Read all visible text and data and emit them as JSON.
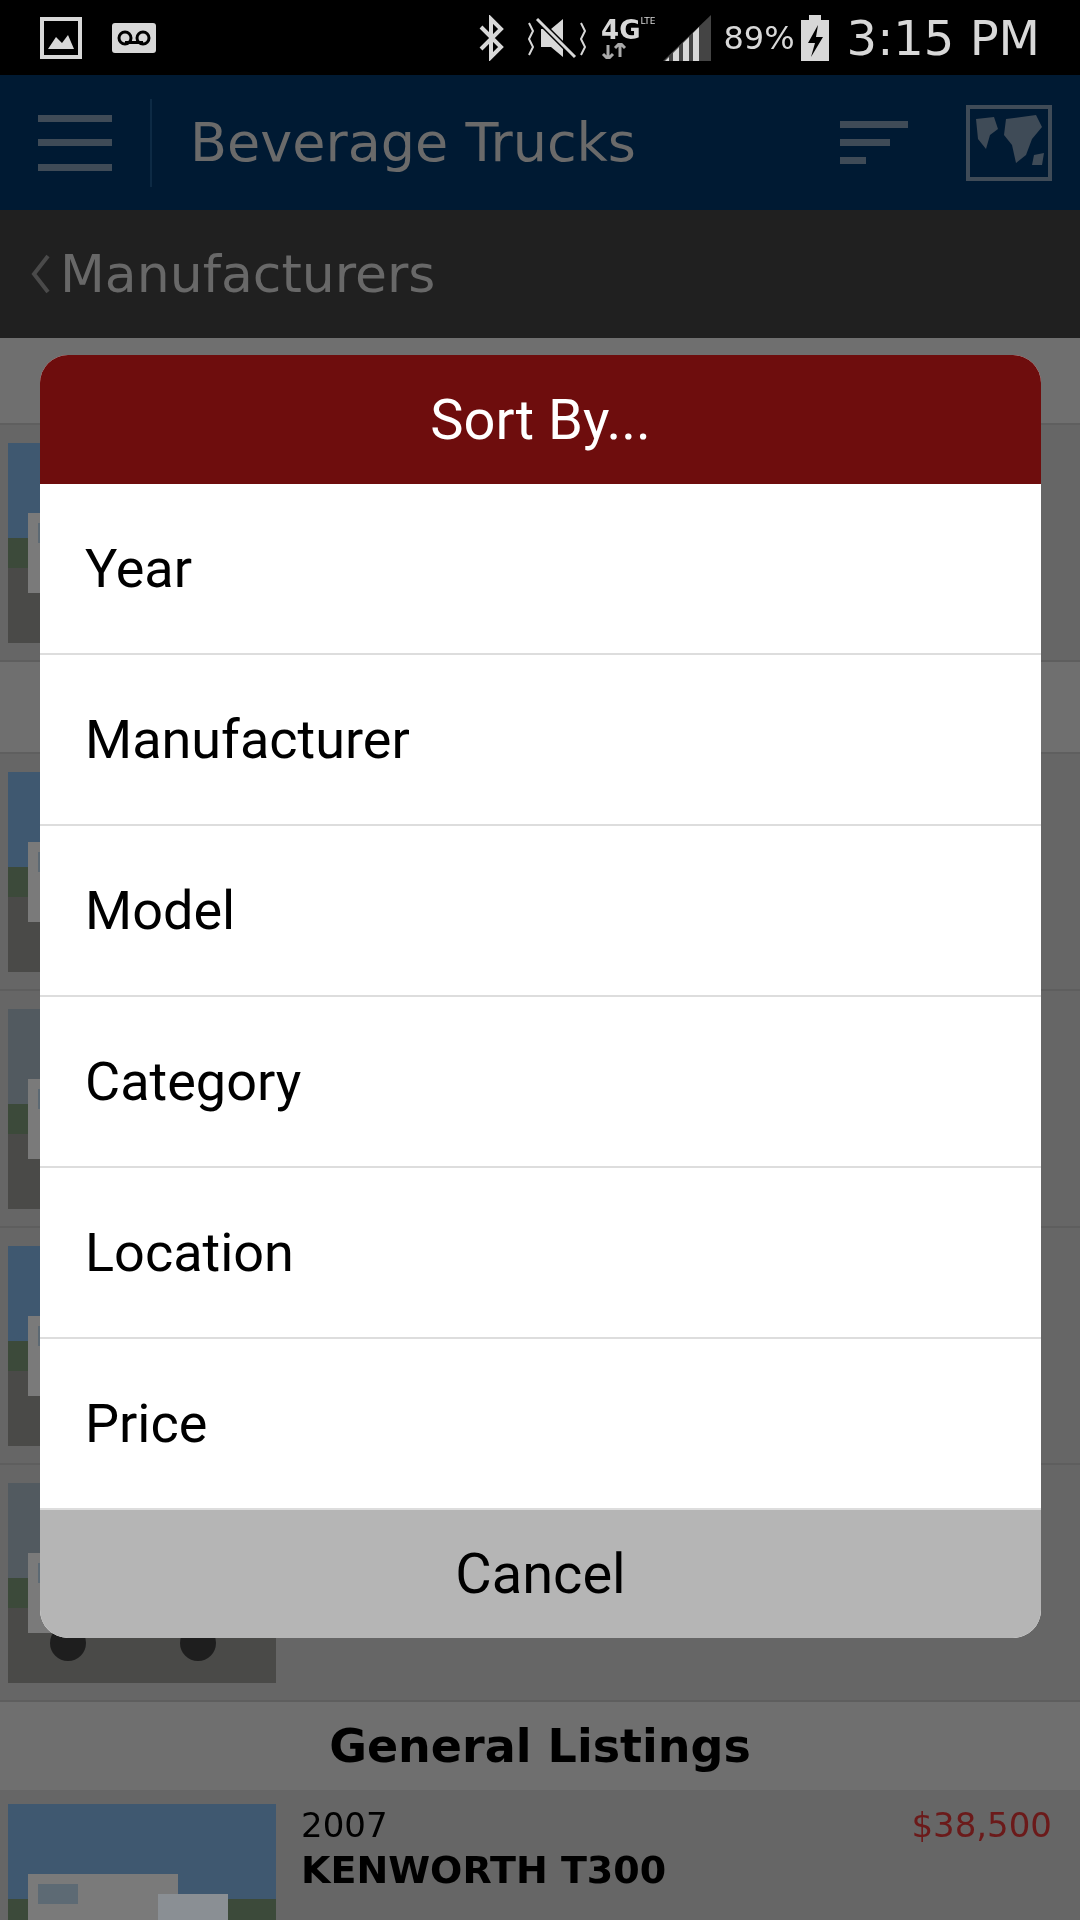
{
  "status_bar": {
    "network": "4G",
    "network_sub": "LTE",
    "battery": "89%",
    "time": "3:15 PM"
  },
  "app_bar": {
    "title": "Beverage Trucks"
  },
  "breadcrumb": {
    "label": "Manufacturers"
  },
  "background_rows": [
    {
      "kind": "strip"
    },
    {
      "kind": "listing"
    },
    {
      "kind": "strip"
    },
    {
      "kind": "listing"
    },
    {
      "kind": "listing"
    },
    {
      "kind": "listing"
    },
    {
      "kind": "listing"
    }
  ],
  "section": {
    "title": "General Listings"
  },
  "listing": {
    "year": "2007",
    "title": "KENWORTH T300",
    "price": "$38,500"
  },
  "dialog": {
    "title": "Sort By...",
    "options": [
      "Year",
      "Manufacturer",
      "Model",
      "Category",
      "Location",
      "Price"
    ],
    "cancel": "Cancel"
  }
}
